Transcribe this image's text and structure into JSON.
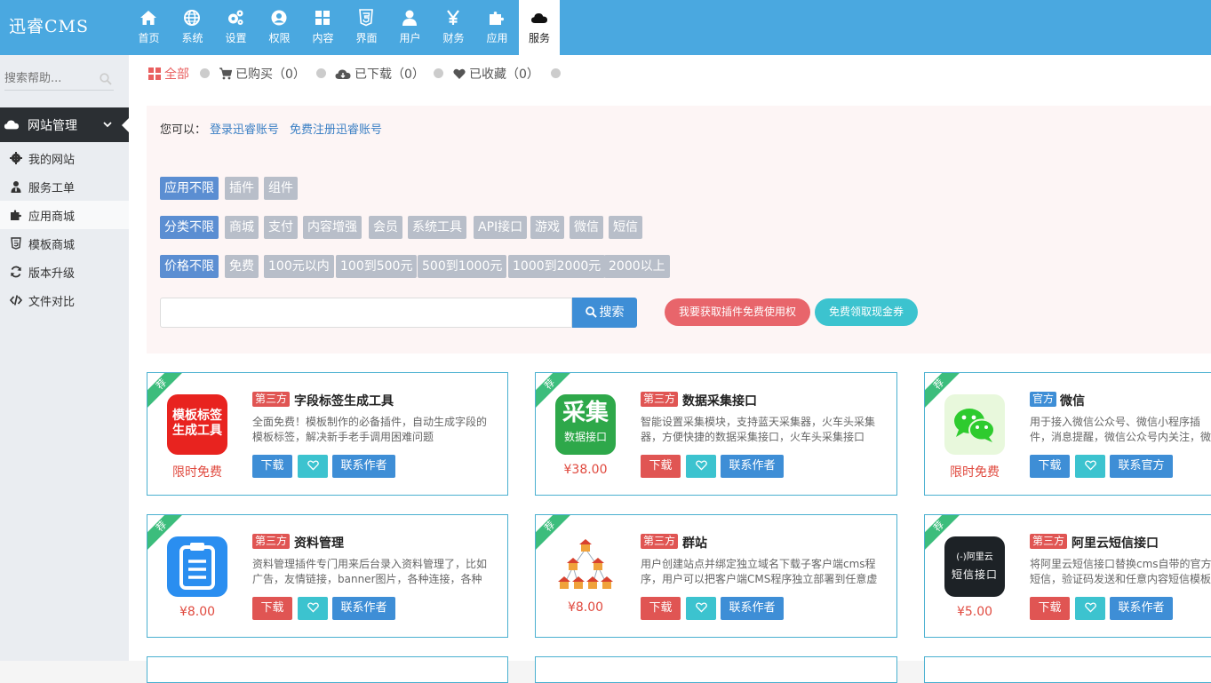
{
  "brand": "迅睿CMS",
  "nav": [
    {
      "label": "首页",
      "icon": "home-icon"
    },
    {
      "label": "系统",
      "icon": "globe-icon"
    },
    {
      "label": "设置",
      "icon": "gears-icon"
    },
    {
      "label": "权限",
      "icon": "user-circle-icon"
    },
    {
      "label": "内容",
      "icon": "grid-icon"
    },
    {
      "label": "界面",
      "icon": "html5-icon"
    },
    {
      "label": "用户",
      "icon": "user-icon"
    },
    {
      "label": "财务",
      "icon": "yen-icon"
    },
    {
      "label": "应用",
      "icon": "puzzle-icon"
    },
    {
      "label": "服务",
      "icon": "cloud-icon"
    }
  ],
  "sidebar": {
    "search_placeholder": "搜索帮助...",
    "group": {
      "label": "网站管理",
      "icon": "cloud-icon"
    },
    "items": [
      {
        "label": "我的网站",
        "icon": "gear-icon"
      },
      {
        "label": "服务工单",
        "icon": "user-tie-icon"
      },
      {
        "label": "应用商城",
        "icon": "puzzle-icon"
      },
      {
        "label": "模板商城",
        "icon": "html5-icon"
      },
      {
        "label": "版本升级",
        "icon": "refresh-icon"
      },
      {
        "label": "文件对比",
        "icon": "code-icon"
      }
    ]
  },
  "tabs": [
    {
      "label": "全部",
      "icon": "grid-icon"
    },
    {
      "label": "已购买（0）",
      "icon": "cart-icon"
    },
    {
      "label": "已下载（0）",
      "icon": "cloud-download-icon"
    },
    {
      "label": "已收藏（0）",
      "icon": "heart-icon"
    }
  ],
  "filter": {
    "prompt": "您可以：",
    "login_link": "登录迅睿账号",
    "register_link": "免费注册迅睿账号",
    "app_types": [
      "应用不限",
      "插件",
      "组件"
    ],
    "categories": [
      "分类不限",
      "商城",
      "支付",
      "内容增强",
      "会员",
      "系统工具",
      "API接口",
      "游戏",
      "微信",
      "短信"
    ],
    "prices": [
      "价格不限",
      "免费",
      "100元以内",
      "100到500元",
      "500到1000元",
      "1000到2000元",
      "2000以上"
    ],
    "search_label": "搜索",
    "promo_free": "我要获取插件免费使用权",
    "promo_coupon": "免费领取现金券"
  },
  "cards": [
    {
      "ribbon": "荐",
      "badge": "第三方",
      "title": "字段标签生成工具",
      "desc": "全面免费！模板制作的必备插件，自动生成字段的模板标签，解决新手老手调用困难问题",
      "price": "限时免费",
      "icon_text": [
        "模板标签",
        "生成工具"
      ],
      "icon_bg": "#e8231f",
      "btn_download": "下载",
      "btn_contact": "联系作者"
    },
    {
      "ribbon": "荐",
      "badge": "第三方",
      "title": "数据采集接口",
      "desc": "智能设置采集模块，支持蓝天采集器，火车头采集器，方便快捷的数据采集接口，火车头采集接口",
      "price": "¥38.00",
      "icon_text": [
        "采集",
        "数据接口"
      ],
      "icon_bg": "#2ea84a",
      "btn_download": "下载",
      "btn_contact": "联系作者"
    },
    {
      "ribbon": "荐",
      "badge": "官方",
      "title": "微信",
      "desc": "用于接入微信公众号、微信小程序插件，消息提醒，微信公众号内关注，微信文章",
      "price": "限时免费",
      "icon_text": [],
      "icon_bg": "#e8f8dc",
      "btn_download": "下载",
      "btn_contact": "联系官方"
    },
    {
      "ribbon": "荐",
      "badge": "第三方",
      "title": "资料管理",
      "desc": "资料管理插件专门用来后台录入资料管理了，比如广告，友情链接，banner图片，各种连接，各种图片",
      "price": "¥8.00",
      "icon_text": [],
      "icon_bg": "#2a8ef0",
      "btn_download": "下载",
      "btn_contact": "联系作者"
    },
    {
      "ribbon": "荐",
      "badge": "第三方",
      "title": "群站",
      "desc": "用户创建站点并绑定独立域名下载子客户端cms程序，用户可以把客户端CMS程序独立部署到任意虚拟主机",
      "price": "¥8.00",
      "icon_text": [],
      "icon_bg": "#ffffff",
      "btn_download": "下载",
      "btn_contact": "联系作者"
    },
    {
      "ribbon": "荐",
      "badge": "第三方",
      "title": "阿里云短信接口",
      "desc": "将阿里云短信接口替换cms自带的官方短信，验证码发送和任意内容短信模板",
      "price": "¥5.00",
      "icon_text": [
        "(-)阿里云",
        "短信接口"
      ],
      "icon_bg": "#1d2226",
      "btn_download": "下载",
      "btn_contact": "联系作者"
    }
  ],
  "colors": {
    "topbar": "#4aa8e0",
    "accent_red": "#e05553",
    "accent_blue": "#3e8ed6",
    "accent_teal": "#3cc3cf"
  }
}
